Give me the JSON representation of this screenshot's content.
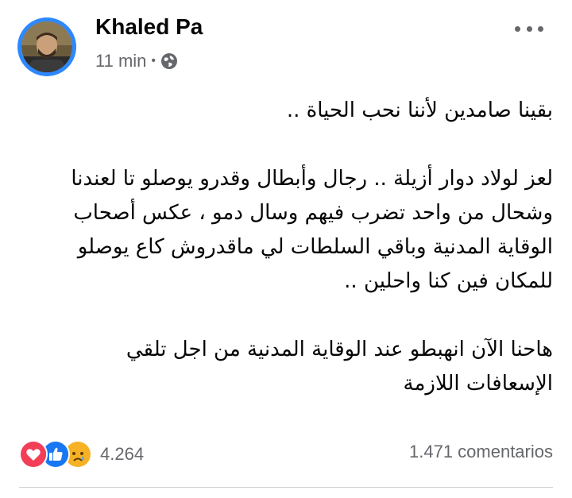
{
  "post": {
    "author": "Khaled Pa",
    "time": "11 min",
    "separator": "•",
    "privacy_icon": "globe-icon",
    "more_icon": "more-horizontal-icon",
    "lines": [
      "بقينا صامدين لأننا نحب الحياة ..",
      "",
      "لعز لولاد دوار أزيلة .. رجال وأبطال وقدرو يوصلو تا لعندنا",
      "وشحال من واحد تضرب فيهم وسال دمو ، عكس أصحاب",
      "الوقاية المدنية وباقي السلطات لي ماقدروش كاع يوصلو",
      "للمكان فين كنا واحلين ..",
      "",
      "هاحنا الآن انهبطو عند الوقاية المدنية من اجل تلقي",
      "الإسعافات اللازمة"
    ]
  },
  "footer": {
    "reaction_icons": [
      "love-icon",
      "like-icon",
      "sad-icon"
    ],
    "reaction_count": "4.264",
    "comments": "1.471 comentarios"
  },
  "colors": {
    "accent": "#2d88ff",
    "secondary_text": "#65676b",
    "love": "#f33e58",
    "like": "#1877f2",
    "sad": "#f7b125"
  }
}
